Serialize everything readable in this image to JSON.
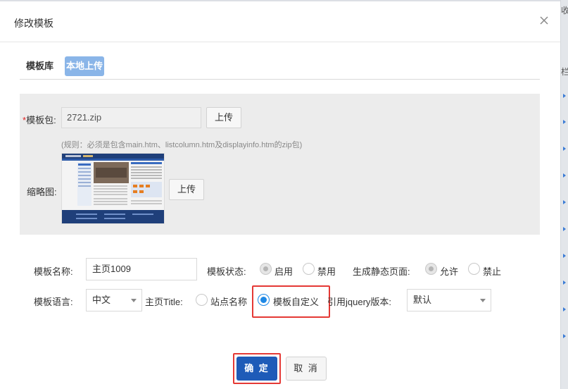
{
  "dialog": {
    "title": "修改模板"
  },
  "tabs": [
    {
      "label": "模板库",
      "active": false
    },
    {
      "label": "本地上传",
      "active": true
    }
  ],
  "upload": {
    "package_label": "模板包:",
    "package_required_mark": "*",
    "package_value": "2721.zip",
    "upload_button": "上传",
    "rule_hint": "(规则：必须是包含main.htm、listcolumn.htm及displayinfo.htm的zip包)",
    "thumbnail_label": "缩略图:",
    "thumbnail_upload_button": "上传"
  },
  "form": {
    "name_label": "模板名称:",
    "name_value": "主页1009",
    "status_label": "模板状态:",
    "status_options": [
      "启用",
      "禁用"
    ],
    "status_selected": "启用",
    "static_label": "生成静态页面:",
    "static_options": [
      "允许",
      "禁止"
    ],
    "static_selected": "允许",
    "language_label": "模板语言:",
    "language_value": "中文",
    "home_title_label": "主页Title:",
    "home_title_options": [
      "站点名称",
      "模板自定义"
    ],
    "home_title_selected": "模板自定义",
    "jquery_label": "引用jquery版本:",
    "jquery_value": "默认"
  },
  "footer": {
    "ok_button": "确 定",
    "cancel_button": "取 消"
  },
  "backdrop": {
    "fragment_top": "收",
    "fragment_mid": "栏"
  },
  "colors": {
    "primary": "#1e5bb8",
    "active_tab": "#8ab5e8",
    "radio_selected": "#1e88e5",
    "highlight_box": "#e53935"
  }
}
